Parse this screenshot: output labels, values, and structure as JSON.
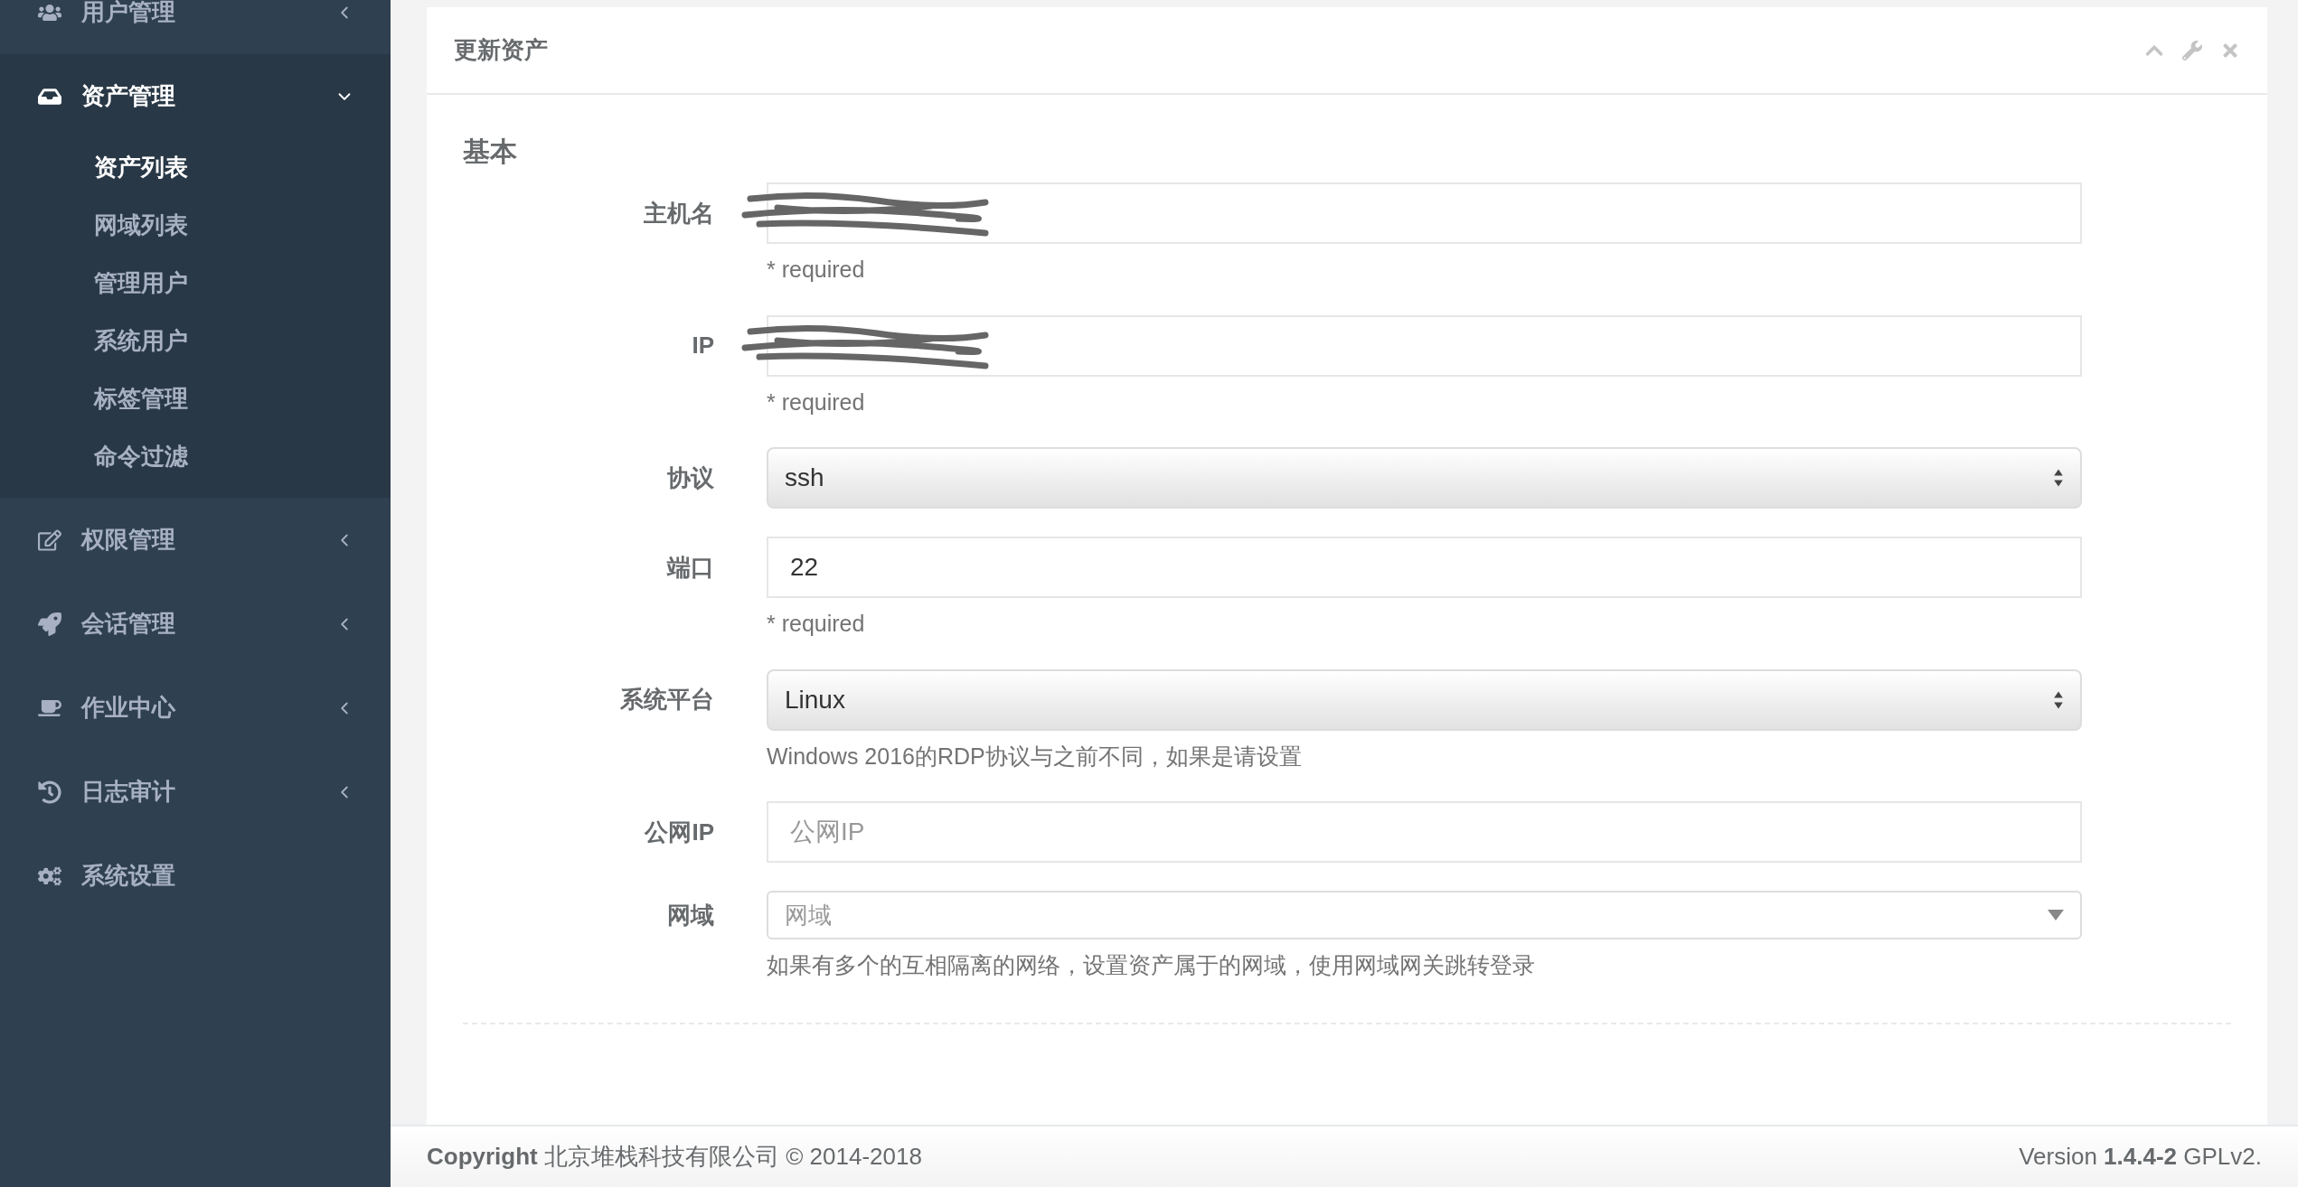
{
  "sidebar": {
    "items": [
      {
        "label": "用户管理",
        "expanded": false
      },
      {
        "label": "资产管理",
        "expanded": true,
        "children": [
          {
            "label": "资产列表",
            "selected": true
          },
          {
            "label": "网域列表",
            "selected": false
          },
          {
            "label": "管理用户",
            "selected": false
          },
          {
            "label": "系统用户",
            "selected": false
          },
          {
            "label": "标签管理",
            "selected": false
          },
          {
            "label": "命令过滤",
            "selected": false
          }
        ]
      },
      {
        "label": "权限管理",
        "expanded": false
      },
      {
        "label": "会话管理",
        "expanded": false
      },
      {
        "label": "作业中心",
        "expanded": false
      },
      {
        "label": "日志审计",
        "expanded": false
      },
      {
        "label": "系统设置"
      }
    ]
  },
  "panel": {
    "title": "更新资产",
    "section": "基本",
    "fields": [
      {
        "kind": "text",
        "label": "主机名",
        "redacted": true,
        "help": "* required"
      },
      {
        "kind": "text",
        "label": "IP",
        "redacted": true,
        "help": "* required"
      },
      {
        "kind": "select",
        "label": "协议",
        "value": "ssh"
      },
      {
        "kind": "text",
        "label": "端口",
        "value": "22",
        "help": "* required"
      },
      {
        "kind": "select",
        "label": "系统平台",
        "value": "Linux",
        "help": "Windows 2016的RDP协议与之前不同，如果是请设置"
      },
      {
        "kind": "text",
        "label": "公网IP",
        "placeholder": "公网IP"
      },
      {
        "kind": "combo",
        "label": "网域",
        "placeholder": "网域",
        "help": "如果有多个的互相隔离的网络，设置资产属于的网域，使用网域网关跳转登录"
      }
    ]
  },
  "footer": {
    "copyright": "**Copyright** 北京堆栈科技有限公司 © 2014-2018",
    "version": "Version **1.4.4-2** GPLv2."
  }
}
